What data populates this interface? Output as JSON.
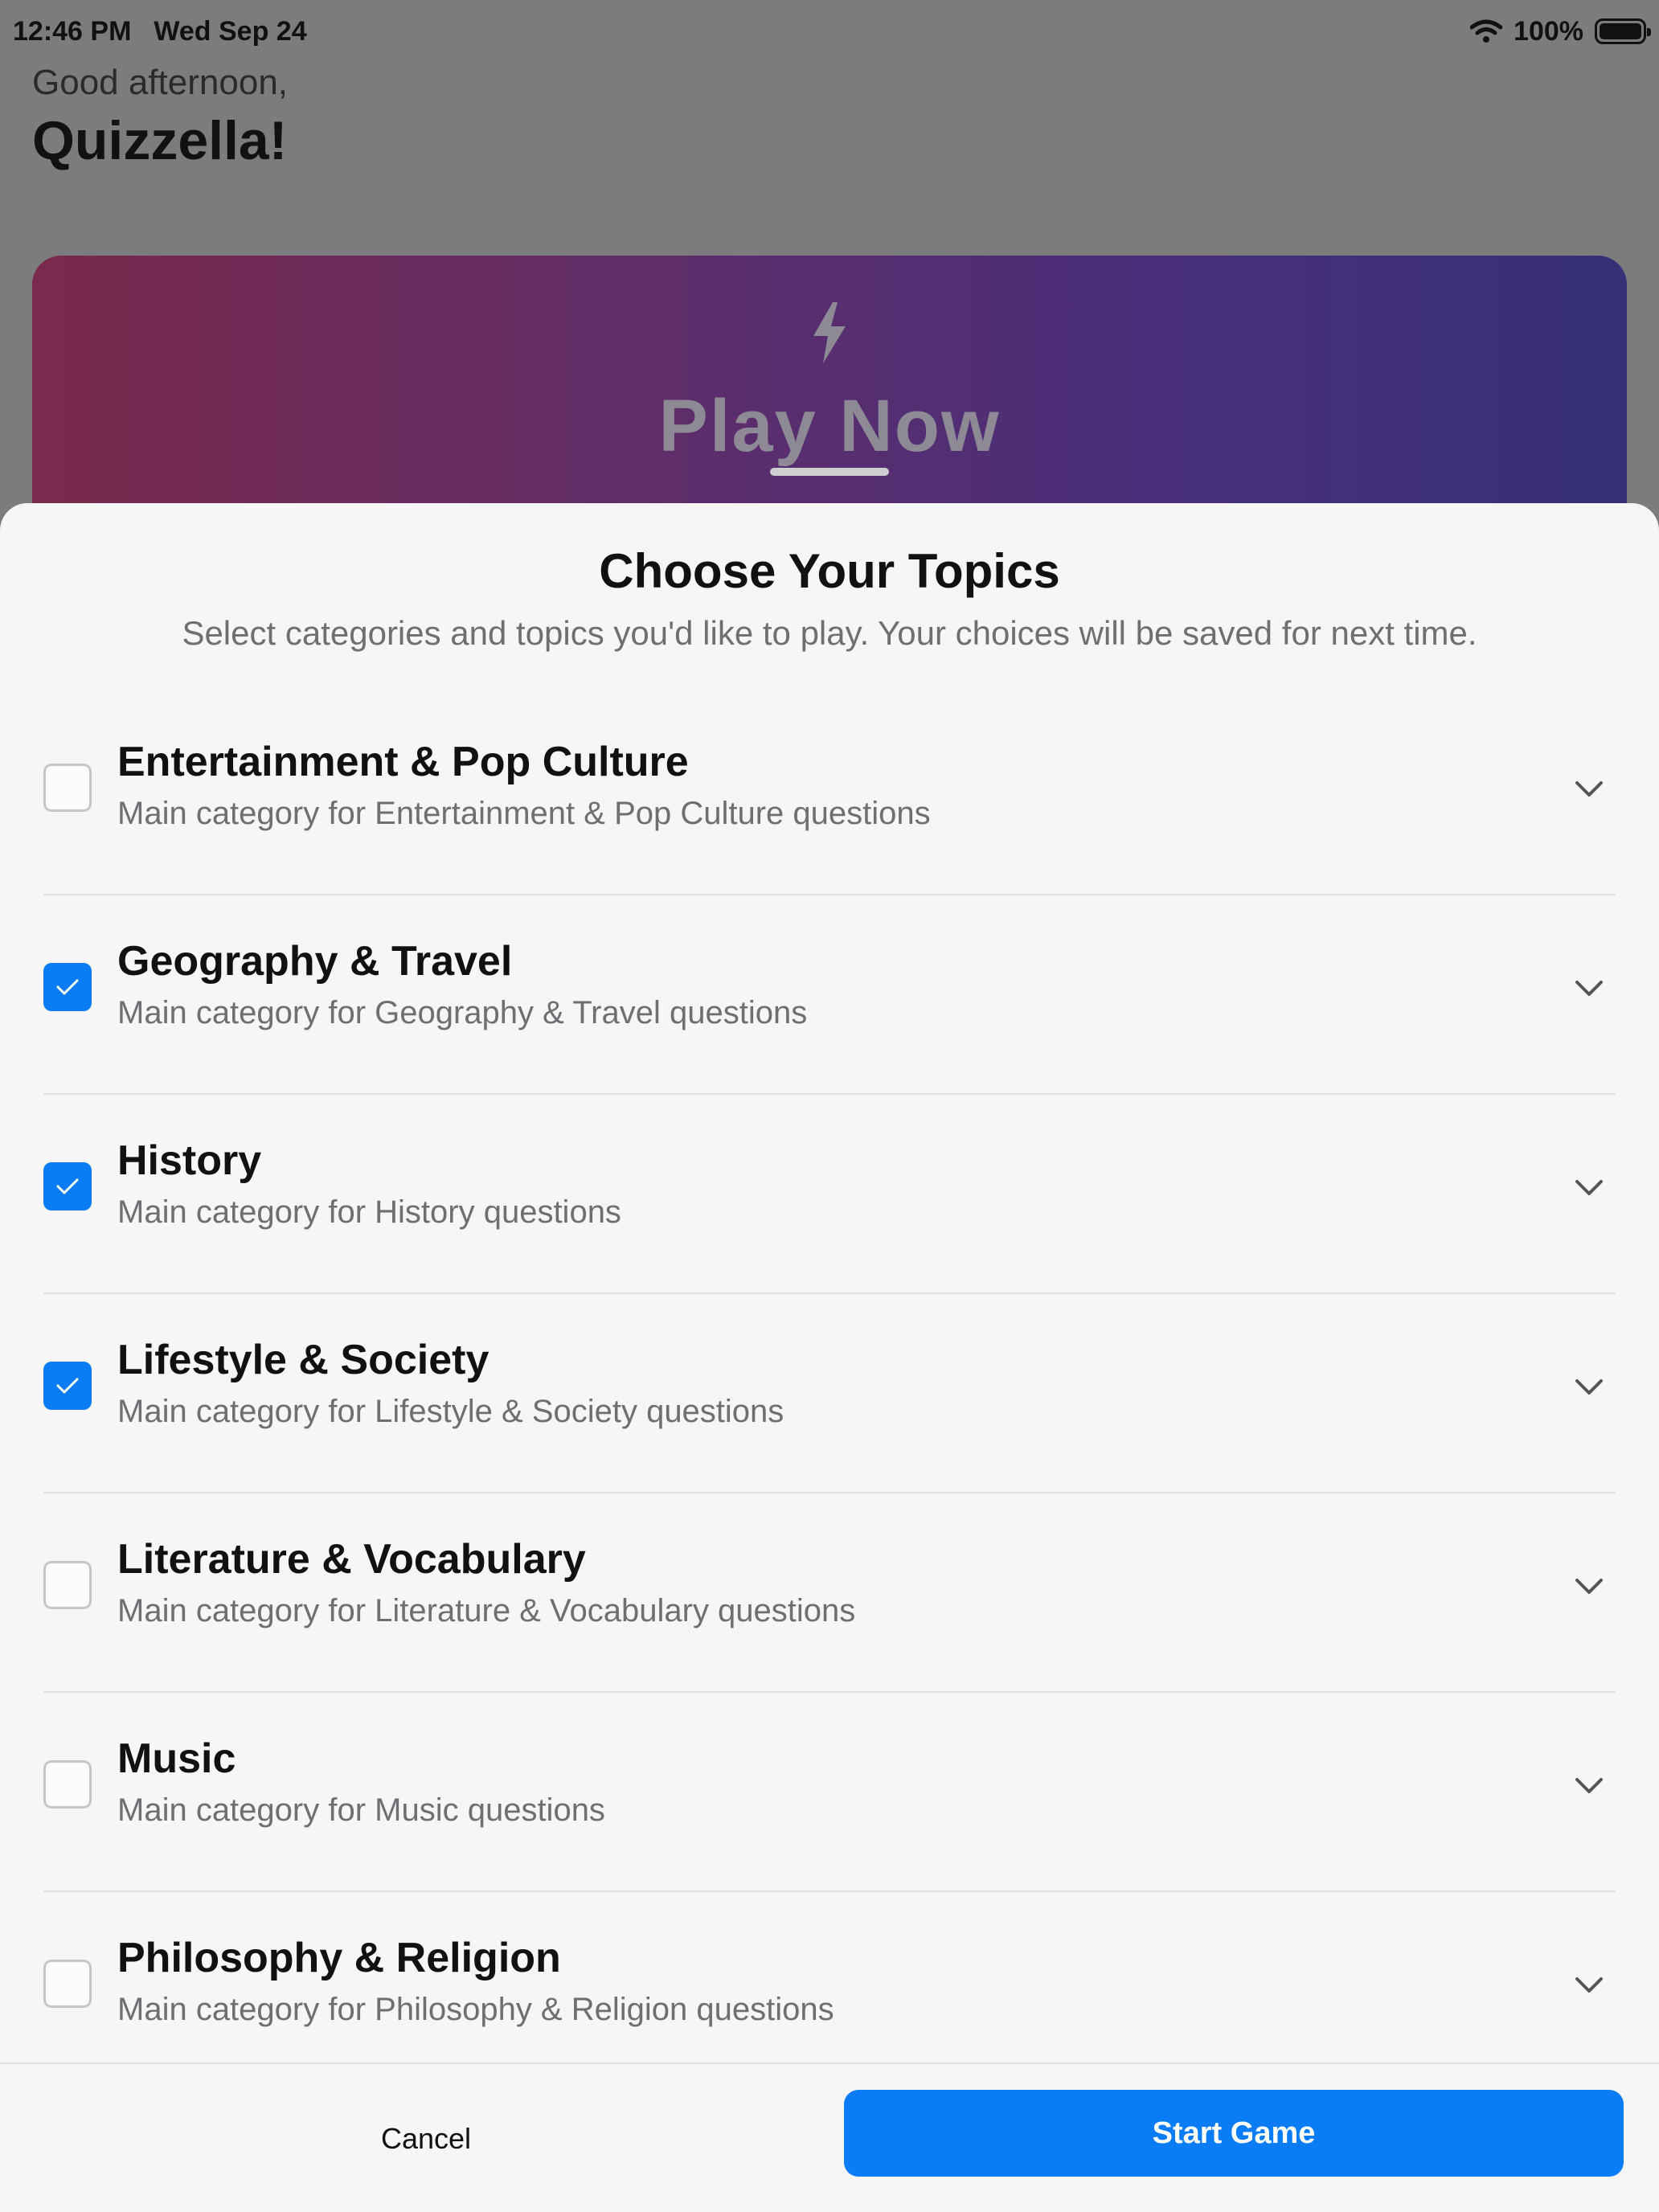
{
  "status_bar": {
    "time": "12:46 PM",
    "date": "Wed Sep 24",
    "battery": "100%"
  },
  "greeting": {
    "line1": "Good afternoon,",
    "name": "Quizzella!"
  },
  "play_card": {
    "title": "Play Now",
    "icon": "bolt-icon"
  },
  "sheet": {
    "title": "Choose Your Topics",
    "subtitle": "Select categories and topics you'd like to play. Your choices will be saved for next time.",
    "topics": [
      {
        "title": "Entertainment & Pop Culture",
        "description": "Main category for Entertainment & Pop Culture questions",
        "checked": false
      },
      {
        "title": "Geography & Travel",
        "description": "Main category for Geography & Travel questions",
        "checked": true
      },
      {
        "title": "History",
        "description": "Main category for History questions",
        "checked": true
      },
      {
        "title": "Lifestyle & Society",
        "description": "Main category for Lifestyle & Society questions",
        "checked": true
      },
      {
        "title": "Literature & Vocabulary",
        "description": "Main category for Literature & Vocabulary questions",
        "checked": false
      },
      {
        "title": "Music",
        "description": "Main category for Music questions",
        "checked": false
      },
      {
        "title": "Philosophy & Religion",
        "description": "Main category for Philosophy & Religion questions",
        "checked": false
      }
    ],
    "cancel_label": "Cancel",
    "start_label": "Start Game"
  },
  "colors": {
    "accent": "#0a7cf5",
    "scrim": "#7c7c7e",
    "card_gradient_start": "#7a2a4c",
    "card_gradient_end": "#363077"
  }
}
